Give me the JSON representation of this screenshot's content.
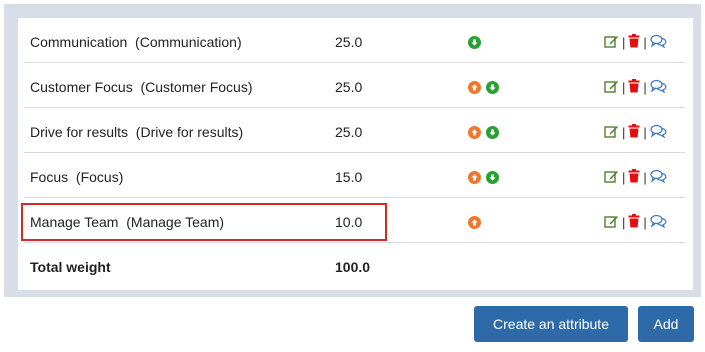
{
  "rows": [
    {
      "name": "Communication  (Communication)",
      "weight": "25.0",
      "up": false,
      "down": true
    },
    {
      "name": "Customer Focus  (Customer Focus)",
      "weight": "25.0",
      "up": true,
      "down": true
    },
    {
      "name": "Drive for results  (Drive for results)",
      "weight": "25.0",
      "up": true,
      "down": true
    },
    {
      "name": "Focus  (Focus)",
      "weight": "15.0",
      "up": true,
      "down": true
    },
    {
      "name": "Manage Team  (Manage Team)",
      "weight": "10.0",
      "up": true,
      "down": false
    }
  ],
  "total": {
    "label": "Total weight",
    "value": "100.0"
  },
  "separators": "|",
  "buttons": {
    "create_attribute": "Create an attribute",
    "add": "Add"
  },
  "colors": {
    "up_arrow": "#f0782d",
    "down_arrow": "#28a032",
    "edit": "#4f7f2a",
    "delete": "#e01010",
    "comment": "#3b78c4",
    "button": "#2e6aa7",
    "highlight": "#d42a2a"
  }
}
